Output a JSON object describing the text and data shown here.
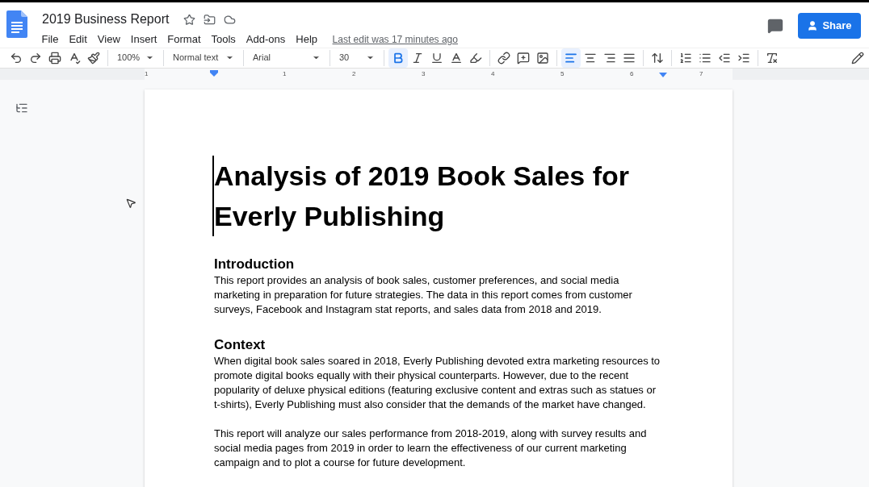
{
  "document_title": "2019 Business Report",
  "menu": [
    "File",
    "Edit",
    "View",
    "Insert",
    "Format",
    "Tools",
    "Add-ons",
    "Help"
  ],
  "last_edit": "Last edit was 17 minutes ago",
  "share_button": "Share",
  "toolbar": {
    "zoom": "100%",
    "style": "Normal text",
    "font": "Arial",
    "font_size": "30",
    "formatting": [
      {
        "kind": "bold",
        "selected": true
      },
      {
        "kind": "italic",
        "selected": false
      },
      {
        "kind": "underline",
        "selected": false
      }
    ],
    "alignment": [
      {
        "kind": "left",
        "selected": true
      },
      {
        "kind": "center",
        "selected": false
      },
      {
        "kind": "right",
        "selected": false
      },
      {
        "kind": "justify",
        "selected": false
      }
    ]
  },
  "ruler": [
    "1",
    "1",
    "2",
    "3",
    "4",
    "5",
    "6",
    "7"
  ],
  "document": {
    "title": "Analysis of 2019 Book Sales for Everly Publishing",
    "sections": [
      {
        "heading": "Introduction",
        "paragraphs": [
          "This report provides an analysis of book sales, customer preferences, and social media marketing in preparation for future strategies. The data in this report comes from customer surveys, Facebook and Instagram stat reports, and sales data from 2018 and 2019."
        ]
      },
      {
        "heading": "Context",
        "paragraphs": [
          "When digital book sales soared in 2018, Everly Publishing devoted extra marketing resources to promote digital books equally with their physical counterparts. However, due to the recent popularity of deluxe physical editions (featuring exclusive content and extras such as statues or t-shirts), Everly Publishing must also consider that the demands of the market have changed.",
          "This report will analyze our sales performance from 2018-2019, along with survey results and social media pages from 2019 in order to learn the effectiveness of our current marketing campaign and to plot a course for future development."
        ]
      }
    ]
  }
}
